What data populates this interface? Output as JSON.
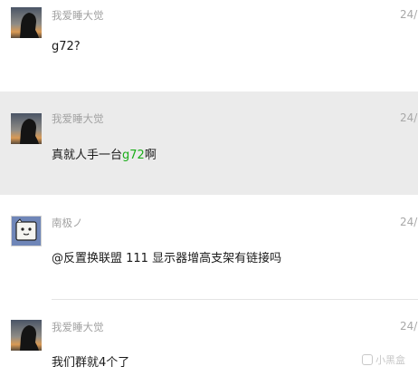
{
  "messages": [
    {
      "sender": "我爱睡大觉",
      "time": "24/",
      "avatar": "night-sky-silhouette-avatar",
      "text_parts": [
        "g72?"
      ]
    },
    {
      "sender": "我爱睡大觉",
      "time": "24/",
      "avatar": "night-sky-silhouette-avatar",
      "highlighted": true,
      "text_parts": [
        "真就人手一台",
        "g72",
        "啊"
      ],
      "highlight_color": "#1aad19"
    },
    {
      "sender": "南极ノ",
      "time": "24/",
      "avatar": "cartoon-face-avatar",
      "text_parts": [
        "@反置换联盟  111 显示器增高支架有链接吗"
      ]
    },
    {
      "sender": "我爱睡大觉",
      "time": "24/",
      "avatar": "night-sky-silhouette-avatar",
      "text_parts": [
        "我们群就4个了"
      ]
    }
  ],
  "watermark": {
    "text": "小黑盒",
    "icon": "heybox-logo-icon"
  },
  "colors": {
    "highlight_background": "#ebebeb",
    "name_gray": "#a2a2a2",
    "mention_green": "#1aad19"
  }
}
